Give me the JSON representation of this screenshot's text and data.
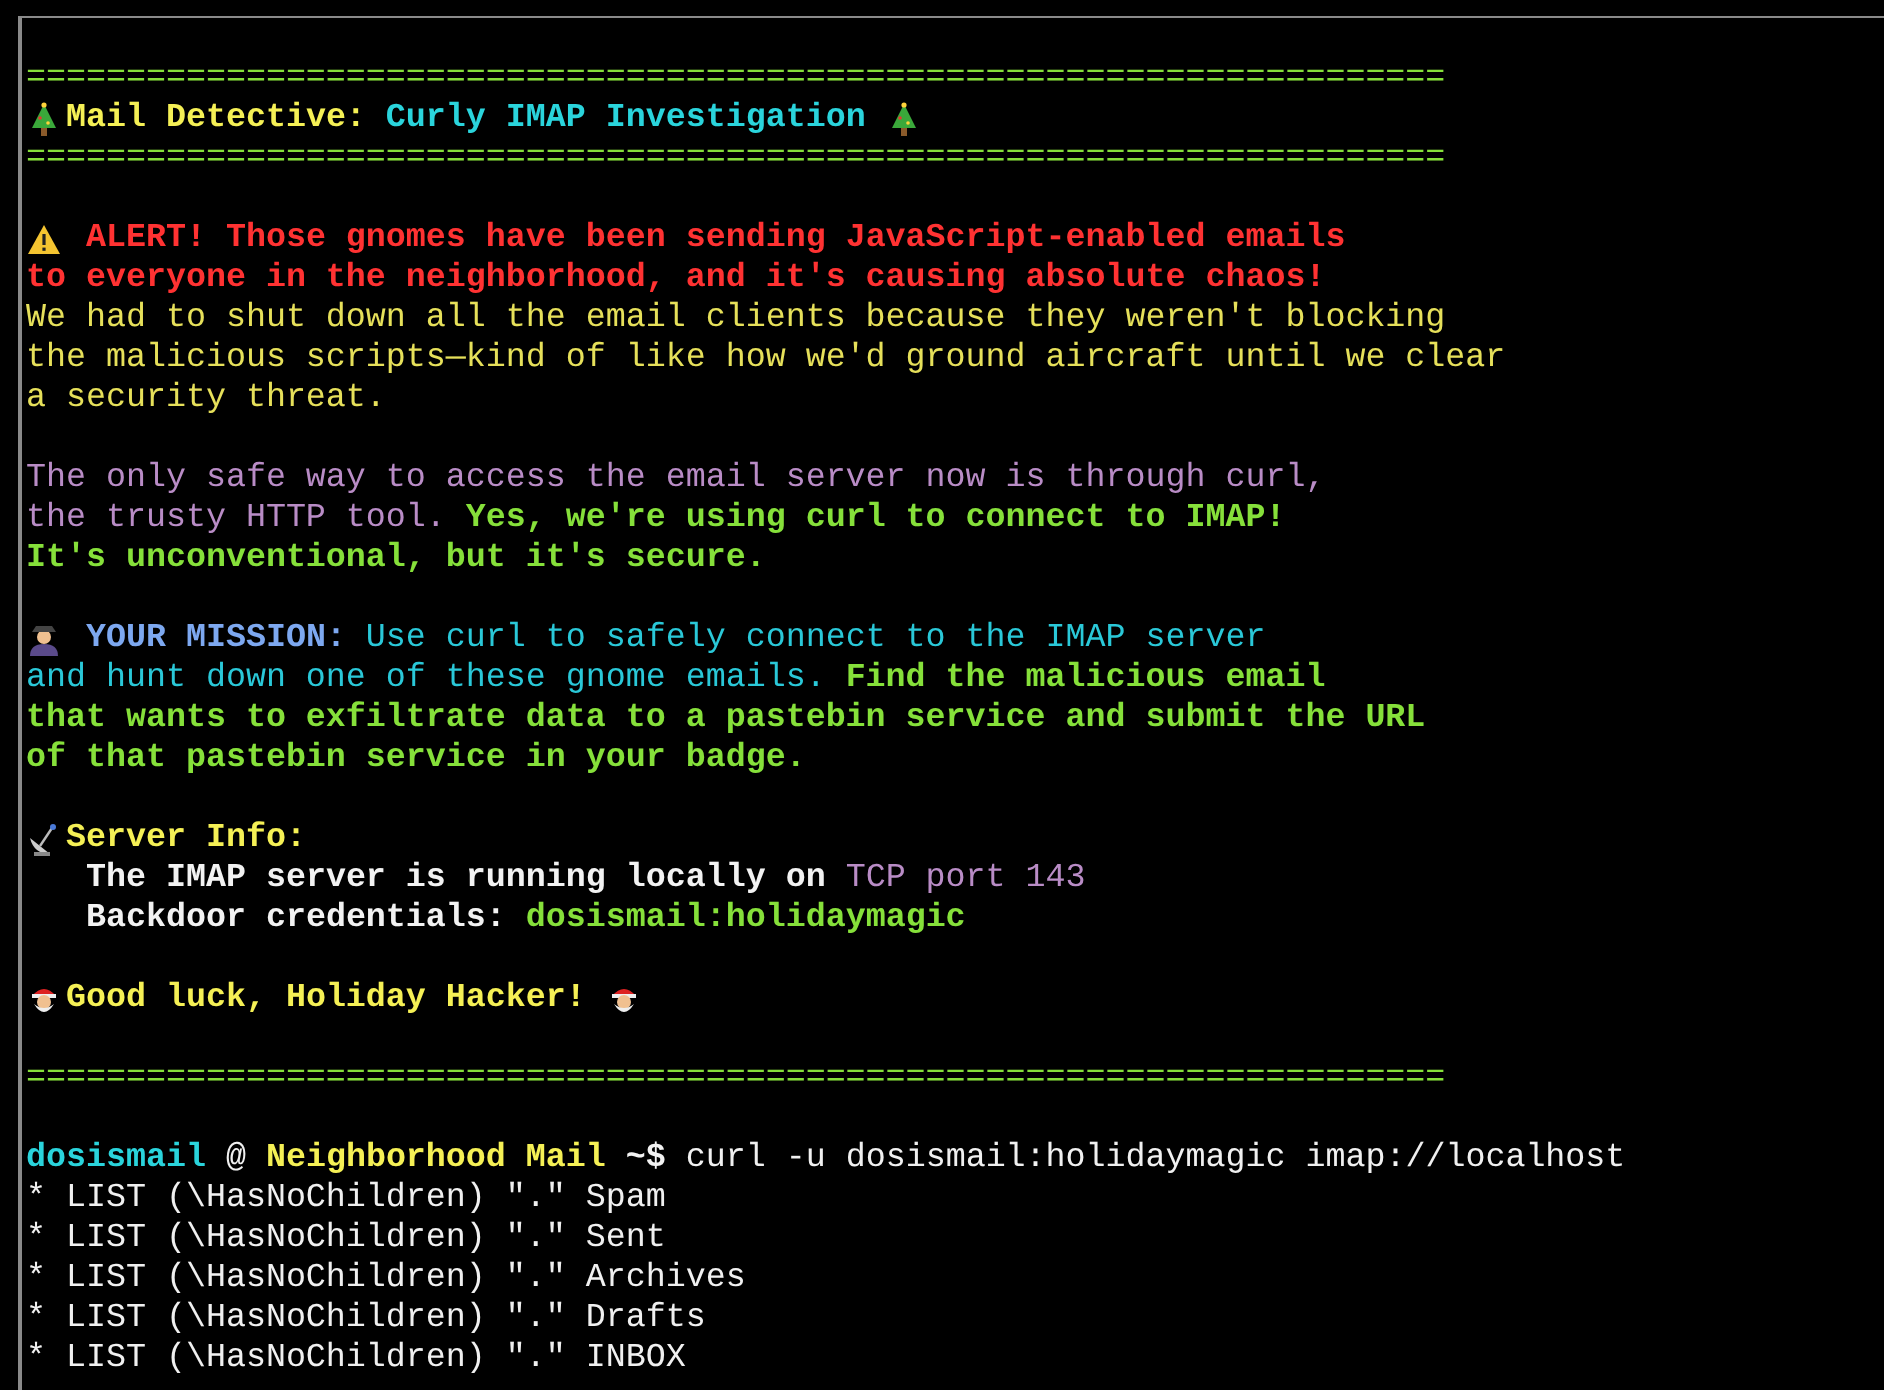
{
  "blocks": [
    {
      "lines": [
        {
          "segments": [
            {
              "kind": "rule",
              "text": "======================================================================="
            }
          ]
        },
        {
          "segments": [
            {
              "kind": "tree"
            },
            {
              "kind": "title",
              "text": "Mail Detective:"
            },
            {
              "kind": "heading",
              "text": " Curly IMAP Investigation "
            },
            {
              "kind": "tree"
            }
          ]
        },
        {
          "segments": [
            {
              "kind": "rule",
              "text": "======================================================================="
            }
          ]
        }
      ]
    },
    {
      "lines": [
        {
          "segments": [
            {
              "kind": "warning"
            },
            {
              "kind": "alert",
              "text": " ALERT! Those gnomes have been sending JavaScript-enabled emails"
            }
          ]
        },
        {
          "segments": [
            {
              "kind": "alert",
              "text": "to everyone in the neighborhood, and it's causing absolute chaos!"
            }
          ]
        },
        {
          "segments": [
            {
              "kind": "body",
              "text": "We had to shut down all the email clients because they weren't blocking"
            }
          ]
        },
        {
          "segments": [
            {
              "kind": "body",
              "text": "the malicious scripts—kind of like how we'd ground aircraft until we clear"
            }
          ]
        },
        {
          "segments": [
            {
              "kind": "body",
              "text": "a security threat."
            }
          ]
        }
      ]
    },
    {
      "lines": [
        {
          "segments": [
            {
              "kind": "note",
              "text": "The only safe way to access the email server now is through curl,"
            }
          ]
        },
        {
          "segments": [
            {
              "kind": "note",
              "text": "the trusty HTTP tool. "
            },
            {
              "kind": "emphasis",
              "text": "Yes, we're using curl to connect to IMAP!"
            }
          ]
        },
        {
          "segments": [
            {
              "kind": "emphasis",
              "text": "It's unconventional, but it's secure."
            }
          ]
        }
      ]
    },
    {
      "lines": [
        {
          "segments": [
            {
              "kind": "detective"
            },
            {
              "kind": "mission",
              "text": " YOUR MISSION:"
            },
            {
              "kind": "info",
              "text": " Use curl to safely connect to the IMAP server"
            }
          ]
        },
        {
          "segments": [
            {
              "kind": "info",
              "text": "and hunt down one of these gnome emails. "
            },
            {
              "kind": "emphasis",
              "text": "Find the malicious email"
            }
          ]
        },
        {
          "segments": [
            {
              "kind": "emphasis",
              "text": "that wants to exfiltrate data to a pastebin service and submit the URL"
            }
          ]
        },
        {
          "segments": [
            {
              "kind": "emphasis",
              "text": "of that pastebin service in your badge."
            }
          ]
        }
      ]
    },
    {
      "lines": [
        {
          "indent": false,
          "segments": [
            {
              "kind": "satellite"
            },
            {
              "kind": "title",
              "text": "Server Info:"
            }
          ]
        },
        {
          "indent": true,
          "segments": [
            {
              "kind": "strong",
              "text": "The IMAP server is running locally on "
            },
            {
              "kind": "note",
              "text": "TCP port 143"
            }
          ]
        },
        {
          "indent": true,
          "segments": [
            {
              "kind": "strong",
              "text": "Backdoor credentials: "
            },
            {
              "kind": "emphasis",
              "text": "dosismail:holidaymagic"
            }
          ]
        }
      ]
    },
    {
      "lines": [
        {
          "segments": [
            {
              "kind": "santa"
            },
            {
              "kind": "title",
              "text": "Good luck, Holiday Hacker! "
            },
            {
              "kind": "santa"
            }
          ]
        }
      ]
    },
    {
      "lines": [
        {
          "segments": [
            {
              "kind": "rule",
              "text": "======================================================================="
            }
          ]
        }
      ]
    },
    {
      "lines": [
        {
          "segments": [
            {
              "kind": "user",
              "text": "dosismail"
            },
            {
              "kind": "plain",
              "text": " @ "
            },
            {
              "kind": "host",
              "text": "Neighborhood Mail"
            },
            {
              "kind": "strong",
              "text": " ~$"
            },
            {
              "kind": "plain",
              "text": " curl -u dosismail:holidaymagic imap://localhost"
            }
          ]
        },
        {
          "segments": [
            {
              "kind": "plain",
              "text": "* LIST (\\HasNoChildren) \".\" Spam"
            }
          ]
        },
        {
          "segments": [
            {
              "kind": "plain",
              "text": "* LIST (\\HasNoChildren) \".\" Sent"
            }
          ]
        },
        {
          "segments": [
            {
              "kind": "plain",
              "text": "* LIST (\\HasNoChildren) \".\" Archives"
            }
          ]
        },
        {
          "segments": [
            {
              "kind": "plain",
              "text": "* LIST (\\HasNoChildren) \".\" Drafts"
            }
          ]
        },
        {
          "segments": [
            {
              "kind": "plain",
              "text": "* LIST (\\HasNoChildren) \".\" INBOX"
            }
          ]
        }
      ]
    }
  ]
}
